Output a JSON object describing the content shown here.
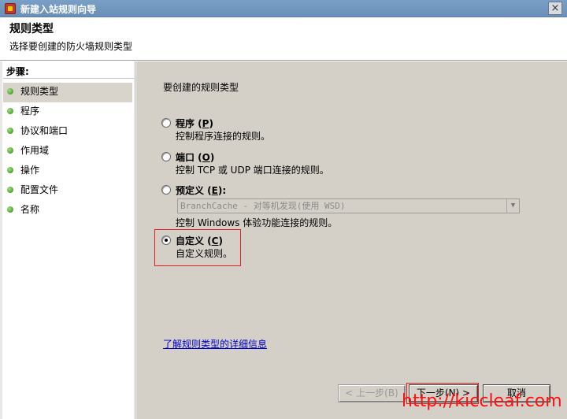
{
  "window": {
    "title": "新建入站规则向导",
    "close_label": "×"
  },
  "header": {
    "title": "规则类型",
    "subtitle": "选择要创建的防火墙规则类型"
  },
  "sidebar": {
    "steps_label": "步骤:",
    "items": [
      {
        "label": "规则类型"
      },
      {
        "label": "程序"
      },
      {
        "label": "协议和端口"
      },
      {
        "label": "作用域"
      },
      {
        "label": "操作"
      },
      {
        "label": "配置文件"
      },
      {
        "label": "名称"
      }
    ]
  },
  "main": {
    "intro": "要创建的规则类型",
    "options": [
      {
        "label_prefix": "程序 (",
        "mnemonic": "P",
        "label_suffix": ")",
        "description": "控制程序连接的规则。",
        "checked": false
      },
      {
        "label_prefix": "端口 (",
        "mnemonic": "O",
        "label_suffix": ")",
        "description": "控制 TCP 或 UDP 端口连接的规则。",
        "checked": false
      },
      {
        "label_prefix": "预定义 (",
        "mnemonic": "E",
        "label_suffix": "):",
        "description": "控制 Windows 体验功能连接的规则。",
        "checked": false
      },
      {
        "label_prefix": "自定义 (",
        "mnemonic": "C",
        "label_suffix": ")",
        "description": "自定义规则。",
        "checked": true
      }
    ],
    "predefined_select": {
      "value": "BranchCache - 对等机发现(使用 WSD)"
    },
    "learn_more_link": "了解规则类型的详细信息"
  },
  "buttons": {
    "back": "< 上一步(B)",
    "next": "下一步(N) >",
    "cancel": "取消"
  },
  "watermark": "http://kiccleaf.com"
}
